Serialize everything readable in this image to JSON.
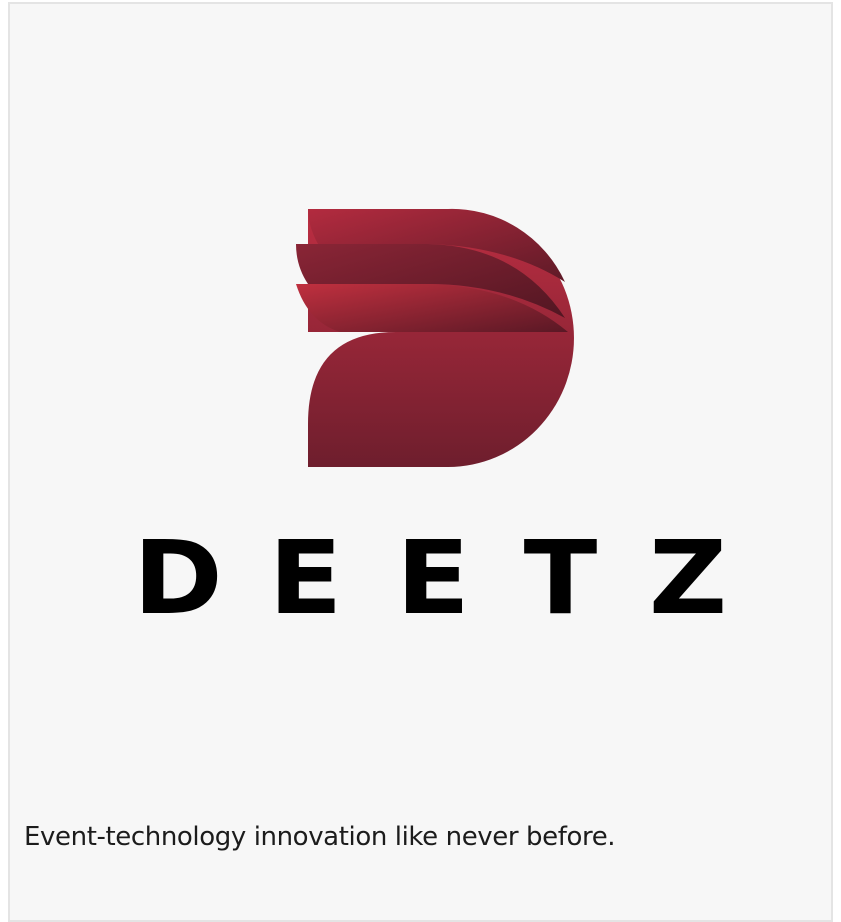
{
  "brand": {
    "name": "DEETZ",
    "letters": [
      "D",
      "E",
      "E",
      "T",
      "Z"
    ],
    "tagline": "Event-technology innovation like never before.",
    "logo_icon": "deetz-logo-icon"
  },
  "colors": {
    "background": "#f7f7f7",
    "border": "#e4e4e4",
    "brand_red": "#b82c40",
    "brand_dark": "#6a1f2c",
    "text": "#000000"
  }
}
